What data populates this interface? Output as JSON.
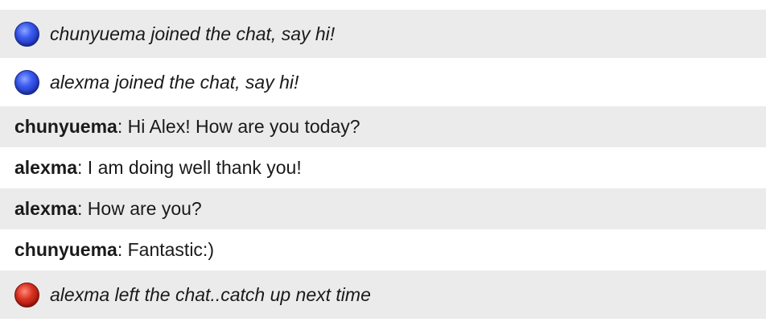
{
  "chat": {
    "rows": [
      {
        "kind": "system",
        "status": "join",
        "icon": "blue-dot-icon",
        "text": "chunyuema joined the chat, say hi!"
      },
      {
        "kind": "system",
        "status": "join",
        "icon": "blue-dot-icon",
        "text": "alexma joined the chat, say hi!"
      },
      {
        "kind": "message",
        "sender": "chunyuema",
        "separator": ": ",
        "text": "Hi Alex! How are you today?"
      },
      {
        "kind": "message",
        "sender": "alexma",
        "separator": ": ",
        "text": "I am doing well thank you!"
      },
      {
        "kind": "message",
        "sender": "alexma",
        "separator": ": ",
        "text": "How are you?"
      },
      {
        "kind": "message",
        "sender": "chunyuema",
        "separator": ": ",
        "text": "Fantastic:)"
      },
      {
        "kind": "system",
        "status": "leave",
        "icon": "red-dot-icon",
        "text": "alexma left the chat..catch up next time"
      }
    ]
  },
  "colors": {
    "row_shaded": "#ebebeb",
    "row_plain": "#ffffff",
    "join_dot": "#2f4fe0",
    "leave_dot": "#c82a1c"
  }
}
